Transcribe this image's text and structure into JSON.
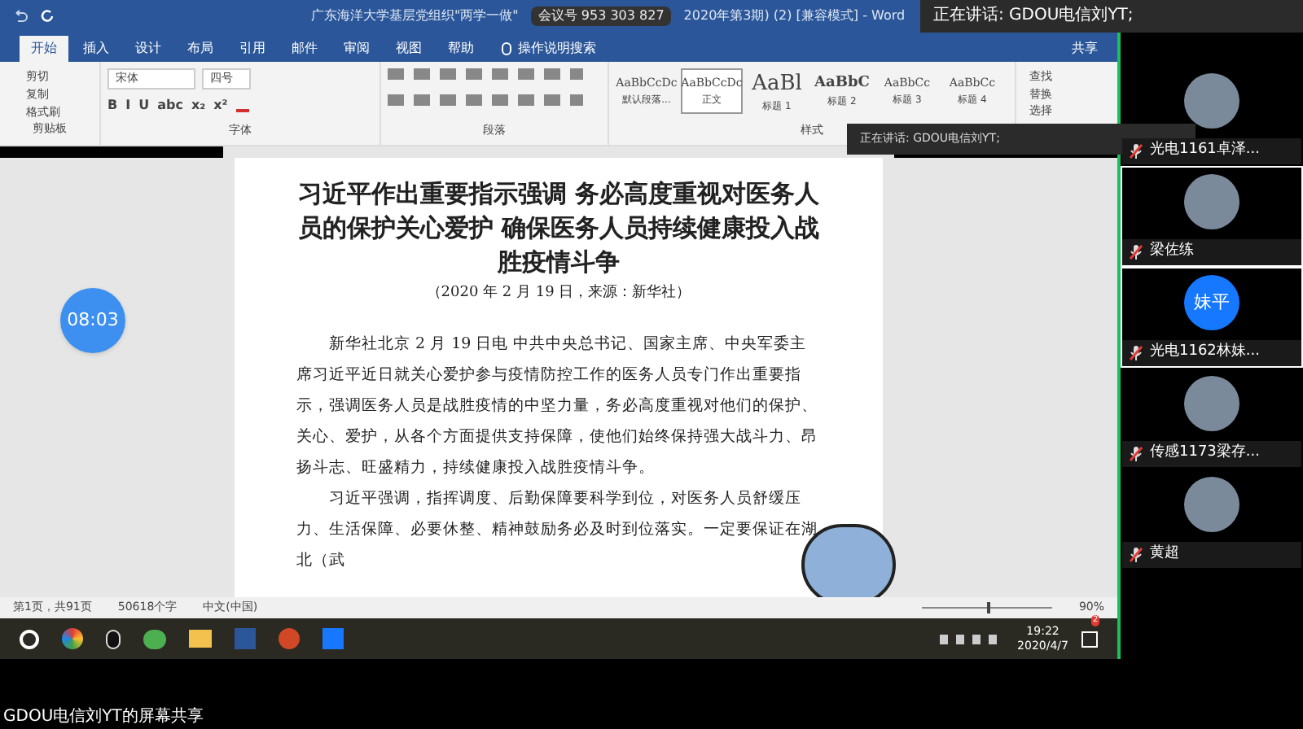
{
  "window": {
    "title": "广东海洋大学基层党组织\"两学一做\"",
    "meeting_id": "会议号 953 303 827",
    "title_end": "2020年第3期) (2) [兼容模式] - Word"
  },
  "speaking_banner": "正在讲话: GDOU电信刘YT;",
  "tabs": [
    {
      "label": "开始",
      "selected": true
    },
    {
      "label": "插入",
      "selected": false
    },
    {
      "label": "设计",
      "selected": false
    },
    {
      "label": "布局",
      "selected": false
    },
    {
      "label": "引用",
      "selected": false
    },
    {
      "label": "邮件",
      "selected": false
    },
    {
      "label": "审阅",
      "selected": false
    },
    {
      "label": "视图",
      "selected": false
    },
    {
      "label": "帮助",
      "selected": false
    }
  ],
  "tell_me": "操作说明搜索",
  "share": "共享",
  "clipboard": {
    "items": [
      "剪切",
      "复制",
      "格式刷"
    ],
    "group": "剪贴板"
  },
  "font": {
    "name": "宋体",
    "size": "四号",
    "buttons": [
      "B",
      "I",
      "U",
      "abc",
      "x₂",
      "x²"
    ],
    "group": "字体"
  },
  "paragraph": {
    "group": "段落"
  },
  "styles": {
    "items": [
      {
        "preview": "AaBbCcDc",
        "label": "默认段落...",
        "selected": false
      },
      {
        "preview": "AaBbCcDc",
        "label": "正文",
        "selected": true
      },
      {
        "preview": "AaBl",
        "label": "标题 1",
        "selected": false
      },
      {
        "preview": "AaBbC",
        "label": "标题 2",
        "selected": false
      },
      {
        "preview": "AaBbCc",
        "label": "标题 3",
        "selected": false
      },
      {
        "preview": "AaBbCc",
        "label": "标题 4",
        "selected": false
      }
    ],
    "group": "样式"
  },
  "editing": [
    "查找",
    "替换",
    "选择"
  ],
  "speaking_toast": "正在讲话: GDOU电信刘YT;",
  "document": {
    "title": "习近平作出重要指示强调  务必高度重视对医务人员的保护关心爱护  确保医务人员持续健康投入战胜疫情斗争",
    "source": "（2020 年 2 月 19 日，来源：新华社）",
    "paragraphs": [
      "新华社北京 2 月 19 日电  中共中央总书记、国家主席、中央军委主席习近平近日就关心爱护参与疫情防控工作的医务人员专门作出重要指示，强调医务人员是战胜疫情的中坚力量，务必高度重视对他们的保护、关心、爱护，从各个方面提供支持保障，使他们始终保持强大战斗力、昂扬斗志、旺盛精力，持续健康投入战胜疫情斗争。",
      "习近平强调，指挥调度、后勤保障要科学到位，对医务人员舒缓压力、生活保障、必要休整、精神鼓励务必及时到位落实。一定要保证在湖北（武"
    ]
  },
  "timer": "08:03",
  "status_bar": {
    "page": "第1页，共91页",
    "words": "50618个字",
    "language": "中文(中国)",
    "zoom": "90%",
    "level": 0.5
  },
  "taskbar": {
    "time": "19:22",
    "date": "2020/4/7",
    "notifications": "2"
  },
  "participants": [
    {
      "name": "光电1161卓泽...",
      "kind": "photo",
      "selected": false
    },
    {
      "name": "梁佐练",
      "kind": "photo",
      "selected": true
    },
    {
      "name": "光电1162林妹...",
      "kind": "initials",
      "initials": "妹平",
      "selected": true
    },
    {
      "name": "传感1173梁存...",
      "kind": "photo",
      "selected": false
    },
    {
      "name": "黄超",
      "kind": "photo",
      "selected": false
    }
  ],
  "share_caption": "GDOU电信刘YT的屏幕共享"
}
